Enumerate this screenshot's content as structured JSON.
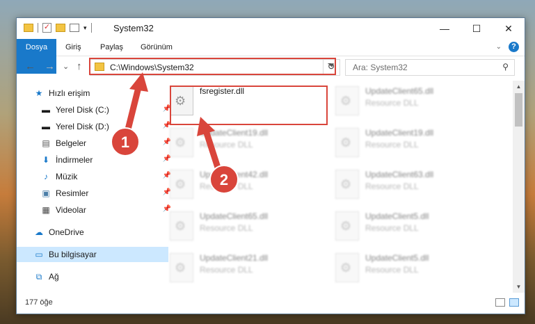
{
  "window": {
    "title": "System32"
  },
  "ribbon": {
    "tabs": [
      "Dosya",
      "Giriş",
      "Paylaş",
      "Görünüm"
    ],
    "help": "?"
  },
  "nav": {
    "back": "←",
    "forward": "→",
    "recent": "⌄",
    "up": "↑"
  },
  "address": {
    "path": "C:\\Windows\\System32"
  },
  "search": {
    "placeholder": "Ara: System32"
  },
  "sidebar": {
    "quick_access": "Hızlı erişim",
    "items": [
      "Yerel Disk (C:)",
      "Yerel Disk (D:)",
      "Belgeler",
      "İndirmeler",
      "Müzik",
      "Resimler",
      "Videolar"
    ],
    "onedrive": "OneDrive",
    "this_pc": "Bu bilgisayar",
    "network": "Ağ"
  },
  "files": {
    "highlighted": {
      "name": "fsregister.dll"
    },
    "items": [
      {
        "name": "UpdateClient65.dll",
        "type": "Resource DLL"
      },
      {
        "name": "UpdateClient19.dll",
        "type": "Resource DLL"
      },
      {
        "name": "UpdateClient19.dll",
        "type": "Resource DLL"
      },
      {
        "name": "UpdateClient42.dll",
        "type": "Resource DLL"
      },
      {
        "name": "UpdateClient63.dll",
        "type": "Resource DLL"
      },
      {
        "name": "UpdateClient65.dll",
        "type": "Resource DLL"
      },
      {
        "name": "UpdateClient5.dll",
        "type": "Resource DLL"
      },
      {
        "name": "UpdateClient21.dll",
        "type": "Resource DLL"
      },
      {
        "name": "UpdateClient5.dll",
        "type": "Resource DLL"
      }
    ]
  },
  "status": {
    "count": "177 öğe"
  },
  "annotations": {
    "step1": "1",
    "step2": "2",
    "color": "#d9453b"
  }
}
